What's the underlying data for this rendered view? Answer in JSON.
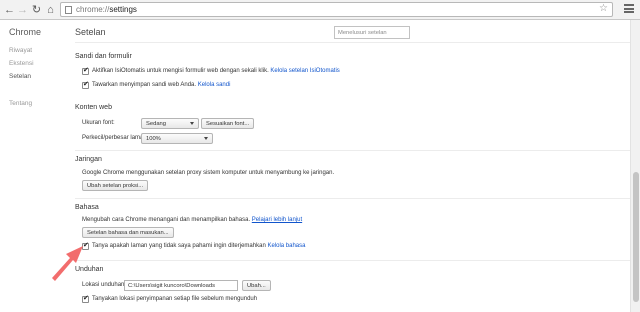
{
  "toolbar": {
    "url_scheme": "chrome://",
    "url_path": "settings",
    "back_icon": "back-arrow-icon",
    "forward_icon": "forward-arrow-icon",
    "reload_icon": "reload-icon",
    "home_icon": "home-icon"
  },
  "sidebar": {
    "title": "Chrome",
    "items": [
      {
        "label": "Riwayat"
      },
      {
        "label": "Ekstensi"
      },
      {
        "label": "Setelan"
      },
      {
        "label": "Tentang"
      }
    ]
  },
  "main": {
    "title": "Setelan",
    "search_placeholder": "Menelusuri setelan",
    "passwords": {
      "heading": "Sandi dan formulir",
      "autofill_text": "Aktifkan IsiOtomatis untuk mengisi formulir web dengan sekali klik.",
      "autofill_link": "Kelola setelan IsiOtomatis",
      "autofill_checked": true,
      "save_pw_text": "Tawarkan menyimpan sandi web Anda.",
      "save_pw_link": "Kelola sandi",
      "save_pw_checked": true
    },
    "web_content": {
      "heading": "Konten web",
      "font_size_label": "Ukuran font:",
      "font_size_value": "Sedang",
      "customize_fonts_button": "Sesuaikan font...",
      "zoom_label": "Perkecil/perbesar laman:",
      "zoom_value": "100%"
    },
    "network": {
      "heading": "Jaringan",
      "text": "Google Chrome menggunakan setelan proxy sistem komputer untuk menyambung ke jaringan.",
      "button": "Ubah setelan proksi..."
    },
    "languages": {
      "heading": "Bahasa",
      "text": "Mengubah cara Chrome menangani dan menampilkan bahasa.",
      "link": "Pelajari lebih lanjut",
      "button": "Setelan bahasa dan masukan...",
      "translate_text": "Tanya apakah laman yang tidak saya pahami ingin diterjemahkan",
      "translate_link": "Kelola bahasa",
      "translate_checked": true
    },
    "downloads": {
      "heading": "Unduhan",
      "location_label": "Lokasi unduhan:",
      "location_value": "C:\\Users\\sigit kuncoro\\Downloads",
      "change_button": "Ubah...",
      "ask_text": "Tanyakan lokasi penyimpanan setiap file sebelum mengunduh",
      "ask_checked": true
    }
  },
  "colors": {
    "link": "#1155cc",
    "annotation_arrow": "#f26d6d"
  }
}
